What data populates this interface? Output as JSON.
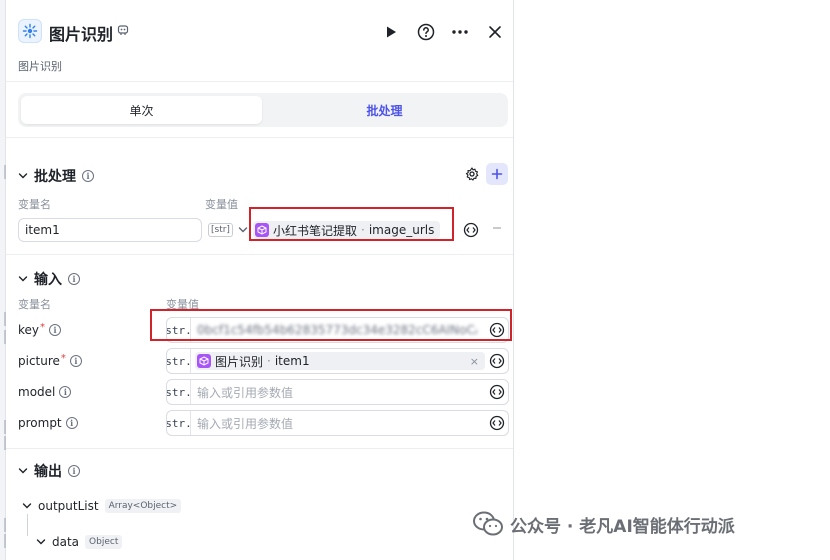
{
  "header": {
    "title": "图片识别",
    "description": "图片识别",
    "buttons": {
      "run": "play-icon",
      "help": "help-icon",
      "more": "more-icon",
      "close": "close-icon"
    }
  },
  "mode_tabs": [
    {
      "label": "单次",
      "active": false
    },
    {
      "label": "批处理",
      "active": true
    }
  ],
  "batch": {
    "title": "批处理",
    "col_name": "变量名",
    "col_value": "变量值",
    "rows": [
      {
        "name": "item1",
        "type": "[str]",
        "ref_node": "小红书笔记提取",
        "ref_separator": "·",
        "ref_field": "image_urls"
      }
    ]
  },
  "input": {
    "title": "输入",
    "col_name": "变量名",
    "col_value": "变量值",
    "rows": [
      {
        "name": "key",
        "required": true,
        "type": "str.",
        "value": "0bcf1c54fb54b62835773dc34e3282cC6AINoCAfd...",
        "kind": "masked"
      },
      {
        "name": "picture",
        "required": true,
        "type": "str.",
        "ref_node": "图片识别",
        "ref_separator": "·",
        "ref_field": "item1",
        "kind": "ref"
      },
      {
        "name": "model",
        "required": false,
        "type": "str.",
        "placeholder": "输入或引用参数值",
        "kind": "empty"
      },
      {
        "name": "prompt",
        "required": false,
        "type": "str.",
        "placeholder": "输入或引用参数值",
        "kind": "empty"
      }
    ]
  },
  "output": {
    "title": "输出",
    "items": [
      {
        "name": "outputList",
        "type": "Array<Object>"
      },
      {
        "name": "data",
        "type": "Object"
      }
    ]
  },
  "watermark": {
    "text": "公众号 · 老凡AI智能体行动派"
  },
  "colors": {
    "accent": "#4d53e8",
    "highlight": "#d2232a",
    "ref_chip": "#a855f7"
  }
}
